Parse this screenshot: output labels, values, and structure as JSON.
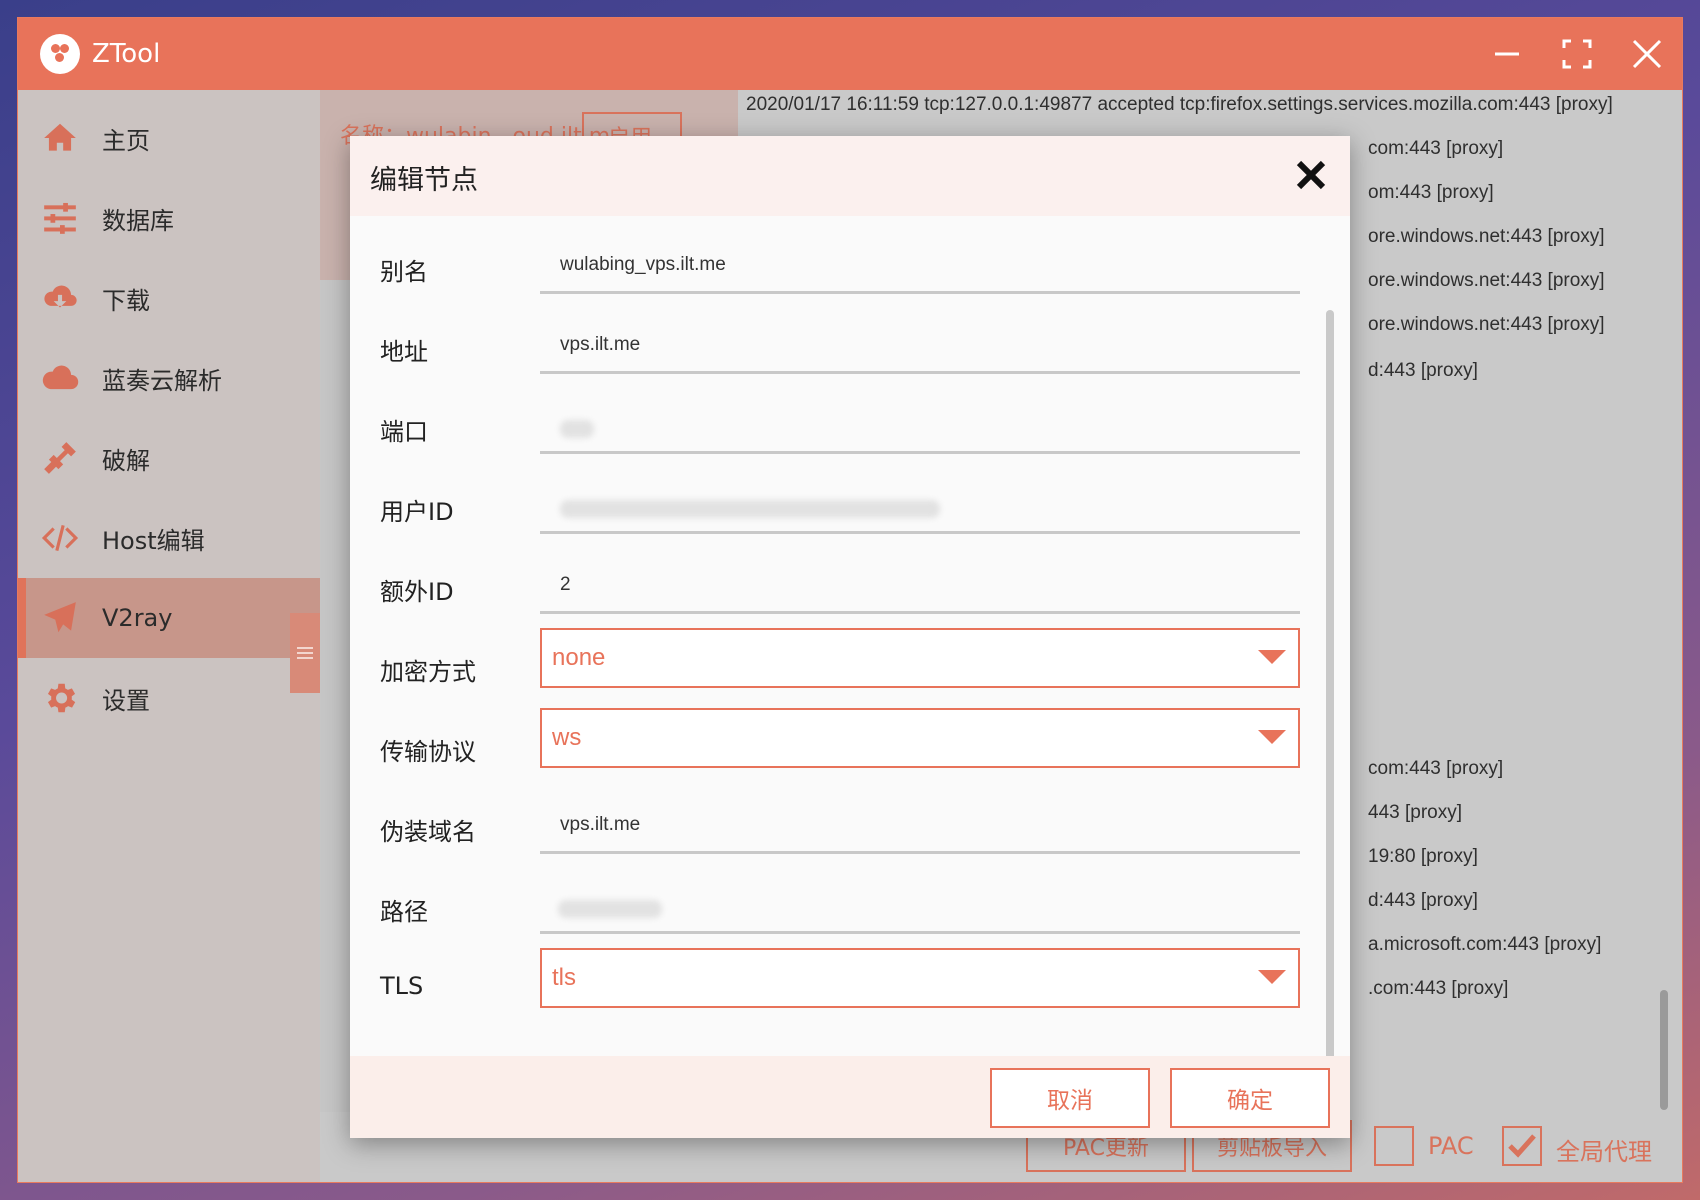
{
  "app": {
    "title": "ZTool"
  },
  "sidebar": {
    "items": [
      {
        "label": "主页",
        "icon": "home-icon"
      },
      {
        "label": "数据库",
        "icon": "sliders-icon"
      },
      {
        "label": "下载",
        "icon": "cloud-download-icon"
      },
      {
        "label": "蓝奏云解析",
        "icon": "cloud-icon"
      },
      {
        "label": "破解",
        "icon": "plug-icon"
      },
      {
        "label": "Host编辑",
        "icon": "code-icon"
      },
      {
        "label": "V2ray",
        "icon": "paper-plane-icon"
      },
      {
        "label": "设置",
        "icon": "gear-icon"
      }
    ],
    "active": "V2ray"
  },
  "node_panel": {
    "name": "名称：wulabin...oud.ilt.m",
    "apply_label": "启用"
  },
  "log": {
    "lines_top": [
      "2020/01/17 16:11:59 tcp:127.0.0.1:49877 accepted tcp:firefox.settings.services.mozilla.com:443 [proxy]"
    ],
    "lines_right": [
      "com:443 [proxy]",
      "om:443 [proxy]",
      "ore.windows.net:443 [proxy]",
      "ore.windows.net:443 [proxy]",
      "ore.windows.net:443 [proxy]",
      "d:443 [proxy]",
      "com:443 [proxy]",
      "443 [proxy]",
      "19:80 [proxy]",
      "d:443 [proxy]",
      "a.microsoft.com:443 [proxy]",
      ".com:443 [proxy]"
    ]
  },
  "bottom": {
    "pac_update": "PAC更新",
    "clipboard_import": "剪贴板导入",
    "pac_label": "PAC",
    "global_label": "全局代理"
  },
  "dialog": {
    "title": "编辑节点",
    "fields": {
      "alias": {
        "label": "别名",
        "value": "wulabing_vps.ilt.me"
      },
      "address": {
        "label": "地址",
        "value": "vps.ilt.me"
      },
      "port": {
        "label": "端口",
        "value": ""
      },
      "user_id": {
        "label": "用户ID",
        "value": ""
      },
      "alter_id": {
        "label": "额外ID",
        "value": "2"
      },
      "security": {
        "label": "加密方式",
        "value": "none"
      },
      "network": {
        "label": "传输协议",
        "value": "ws"
      },
      "host": {
        "label": "伪装域名",
        "value": "vps.ilt.me"
      },
      "path": {
        "label": "路径",
        "value": ""
      },
      "tls": {
        "label": "TLS",
        "value": "tls"
      }
    },
    "cancel_label": "取消",
    "ok_label": "确定"
  },
  "colors": {
    "accent": "#e8735a",
    "sidebar_active": "#c7968a"
  }
}
